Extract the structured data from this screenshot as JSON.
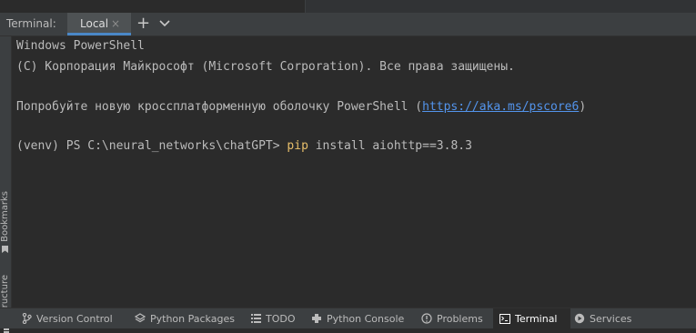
{
  "toolwindow": {
    "title": "Terminal:",
    "tab_label": "Local",
    "close_glyph": "×",
    "plus_glyph": "+"
  },
  "left_stripe": {
    "bookmarks_label": "Bookmarks",
    "structure_label": "Structure"
  },
  "terminal": {
    "line1": "Windows PowerShell",
    "line2": "(C) Корпорация Майкрософт (Microsoft Corporation). Все права защищены.",
    "line3_prefix": "Попробуйте новую кроссплатформенную оболочку PowerShell (",
    "line3_link": "https://aka.ms/pscore6",
    "line3_suffix": ")",
    "prompt": "(venv) PS C:\\neural_networks\\chatGPT> ",
    "command_keyword": "pip",
    "command_args": " install aiohttp==3.8.3"
  },
  "bottom_bar": {
    "items": [
      {
        "label": "Version Control",
        "icon": "branch-icon"
      },
      {
        "label": "Python Packages",
        "icon": "layers-icon"
      },
      {
        "label": "TODO",
        "icon": "list-icon"
      },
      {
        "label": "Python Console",
        "icon": "console-icon"
      },
      {
        "label": "Problems",
        "icon": "warning-icon"
      },
      {
        "label": "Terminal",
        "icon": "terminal-icon",
        "active": true
      },
      {
        "label": "Services",
        "icon": "play-icon"
      }
    ]
  },
  "colors": {
    "background": "#2b2b2b",
    "panel": "#3c3f41",
    "text": "#bbbbbb",
    "link": "#5394ec",
    "command": "#e8bf6a",
    "tab_underline": "#4a88c7"
  }
}
